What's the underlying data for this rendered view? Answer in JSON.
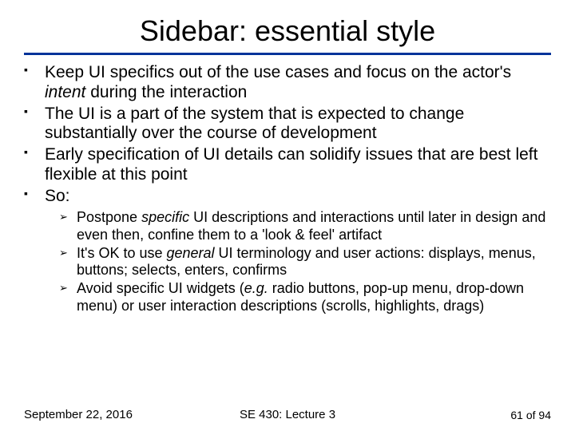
{
  "title": "Sidebar: essential style",
  "bullets": {
    "b1a": "Keep UI specifics out of the use cases and focus on the actor's ",
    "b1b": "intent",
    "b1c": " during the interaction",
    "b2": "The UI is a part of the system that is expected to change substantially over the course of development",
    "b3": "Early specification of UI details can solidify issues that are best left flexible at this point",
    "b4": "So:"
  },
  "sub": {
    "s1a": "Postpone ",
    "s1b": "specific",
    "s1c": " UI descriptions and interactions until later in design and even then, confine them to a 'look & feel' artifact",
    "s2a": "It's OK to use ",
    "s2b": "general",
    "s2c": " UI terminology and user actions: displays, menus, buttons; selects, enters, confirms",
    "s3a": "Avoid specific UI widgets (",
    "s3b": "e.g.",
    "s3c": " radio buttons, pop-up menu, drop-down menu) or user interaction descriptions (scrolls, highlights, drags)"
  },
  "footer": {
    "date": "September 22, 2016",
    "course": "SE 430: Lecture 3",
    "page": "61 of 94"
  }
}
